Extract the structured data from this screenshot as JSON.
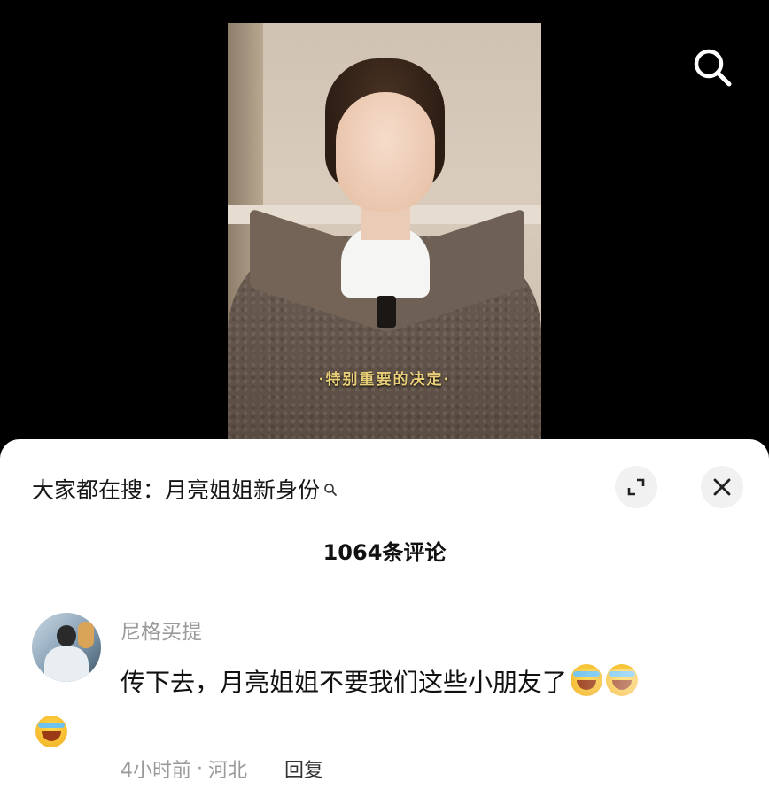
{
  "video": {
    "subtitle": "·特别重要的决定·"
  },
  "top_bar": {
    "search_icon": "search-icon"
  },
  "sheet": {
    "search_prefix": "大家都在搜：",
    "search_query": "月亮姐姐新身份",
    "search_glyph_icon": "search-icon",
    "expand_icon": "expand-icon",
    "close_icon": "close-icon",
    "comment_count": "1064条评论"
  },
  "comments": [
    {
      "username": "尼格买提",
      "text": "传下去，月亮姐姐不要我们这些小朋友了",
      "emoji": "laugh-cry-emoji",
      "time": "4小时前",
      "separator": "·",
      "location": "河北",
      "reply_label": "回复"
    }
  ]
}
